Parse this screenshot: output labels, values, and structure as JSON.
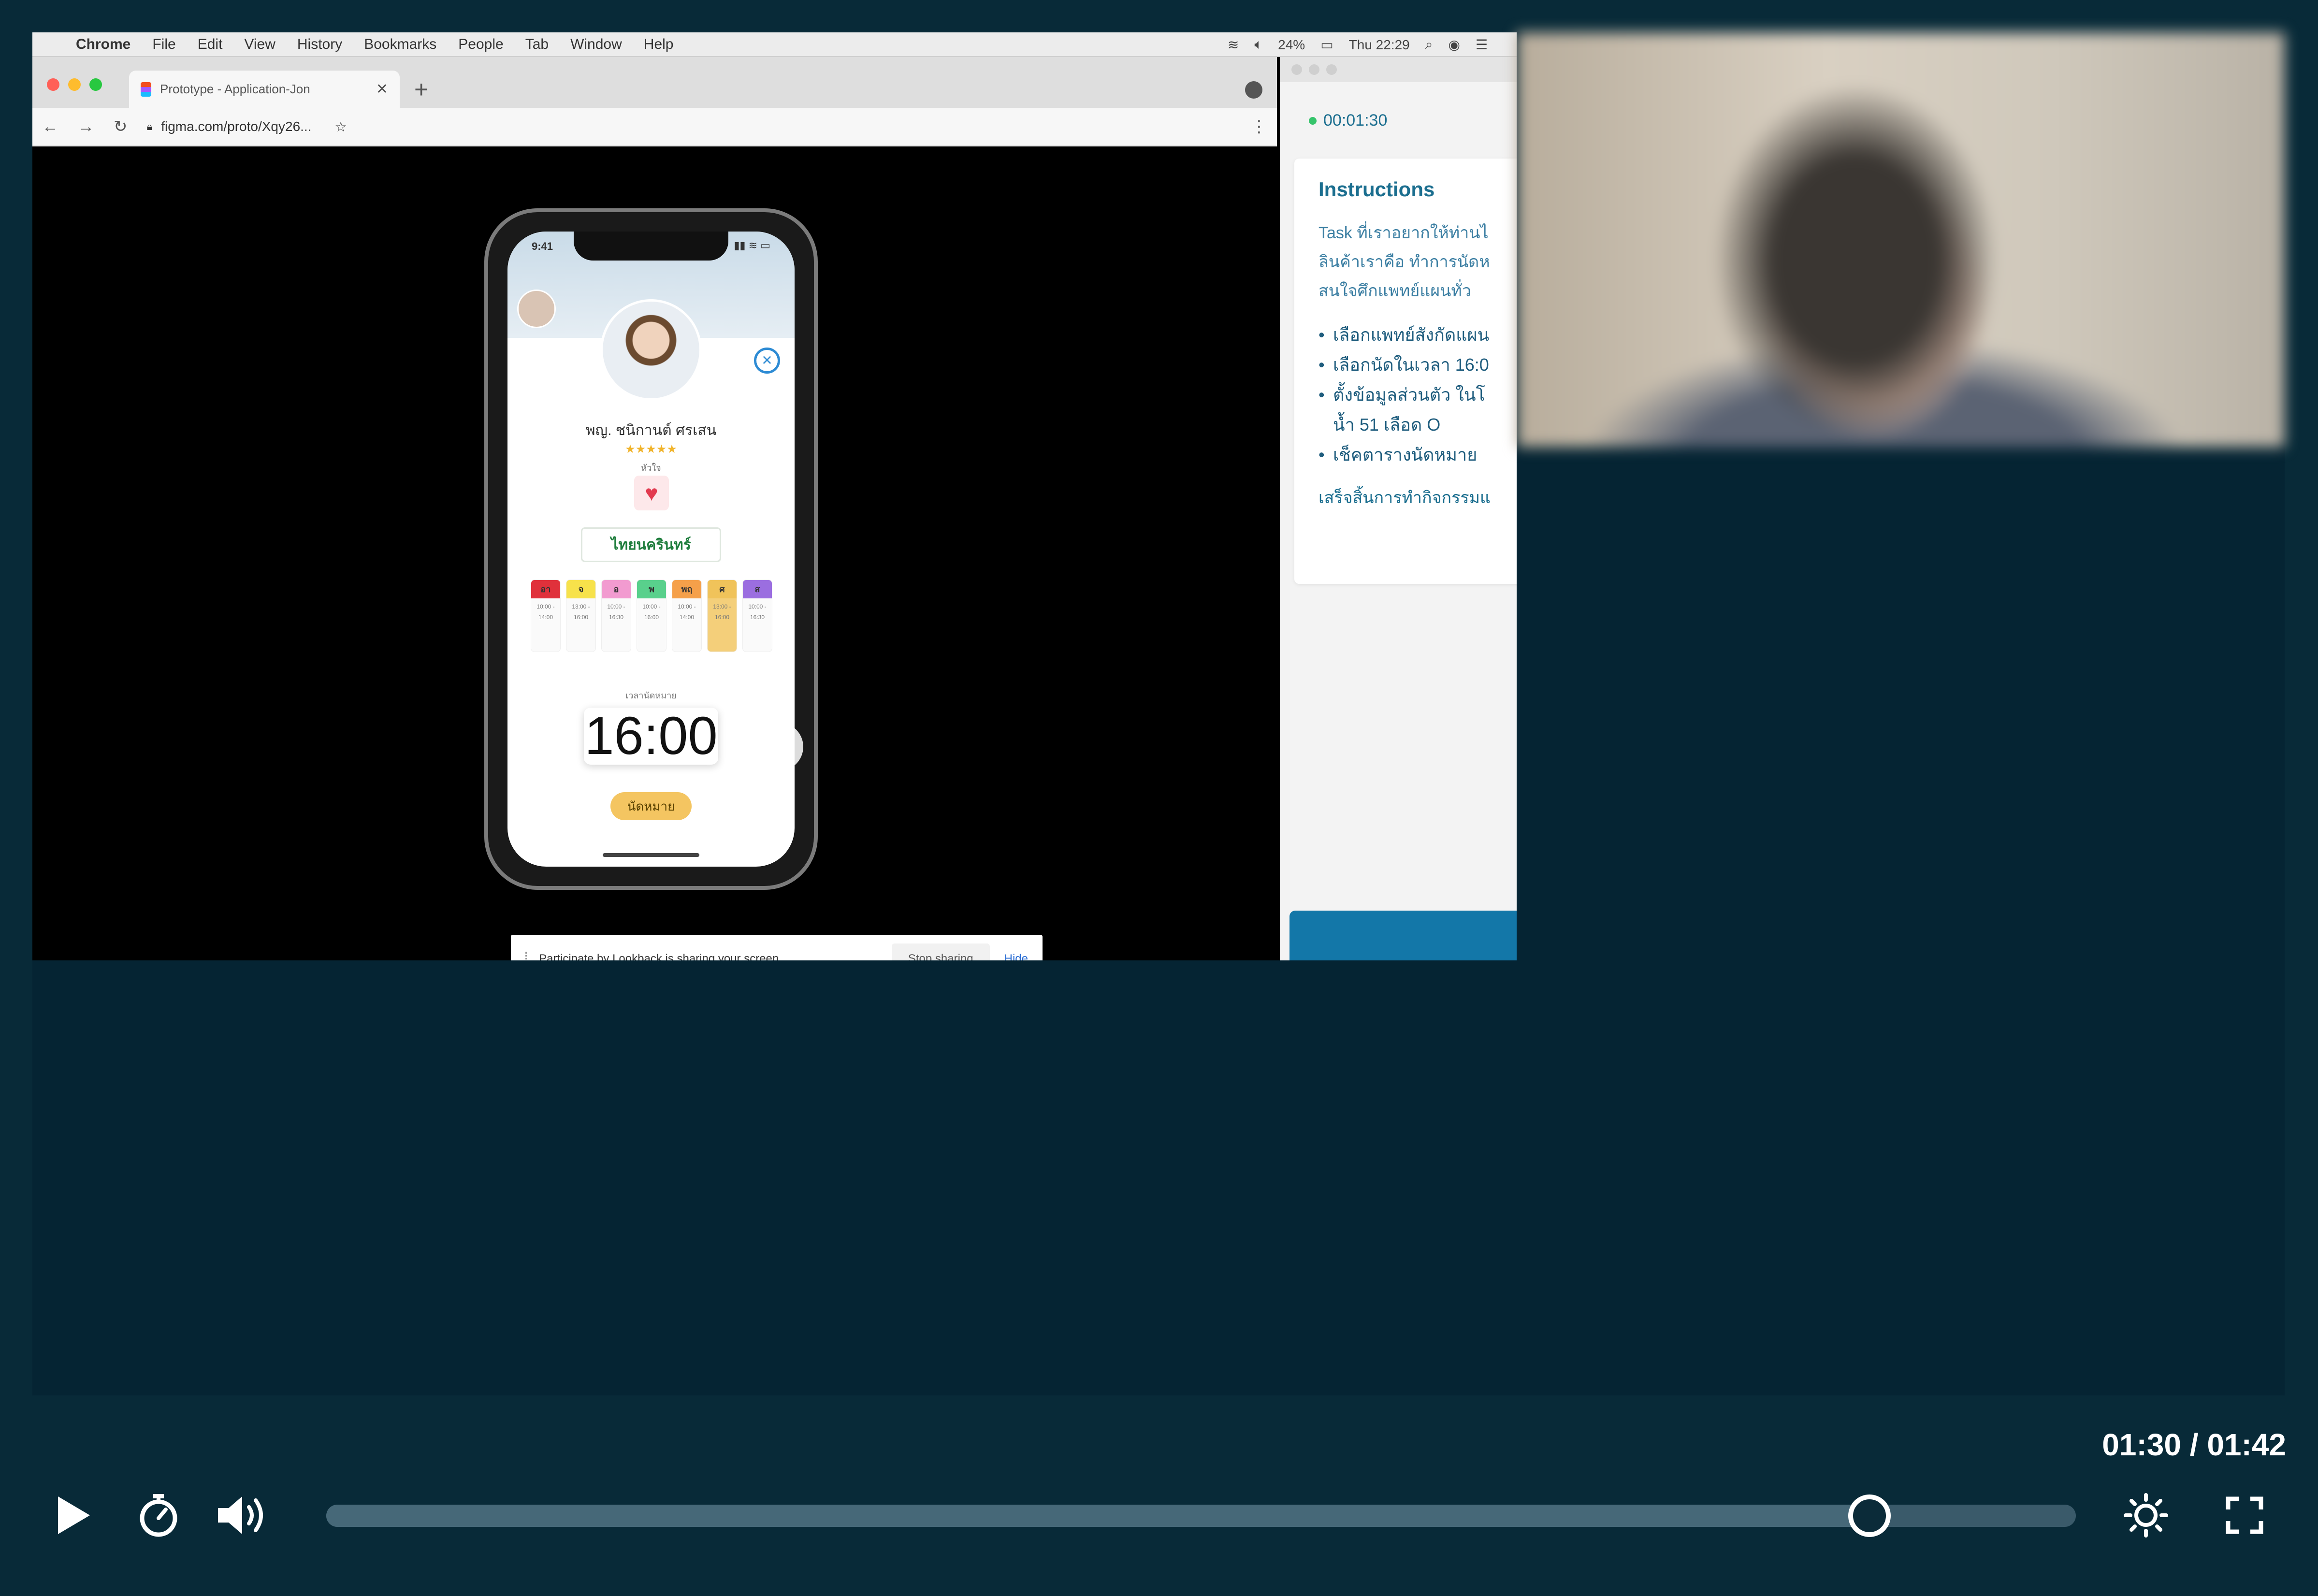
{
  "menubar": {
    "app": "Chrome",
    "items": [
      "File",
      "Edit",
      "View",
      "History",
      "Bookmarks",
      "People",
      "Tab",
      "Window",
      "Help"
    ],
    "battery": "24%",
    "clock": "Thu 22:29"
  },
  "browser": {
    "tab_title": "Prototype - Application-Jon",
    "url": "figma.com/proto/Xqy26...",
    "colors": {
      "close": "#ff5f57",
      "minimize": "#febc2e",
      "zoom": "#28c840"
    }
  },
  "phone": {
    "status_time": "9:41",
    "doctor_name": "พญ. ชนิกานต์ ศรเสน",
    "rating": "★★★★★",
    "specialty": "หัวใจ",
    "hospital": "ไทยนครินทร์",
    "days": [
      {
        "tag": "อา",
        "color": "#e0313b",
        "time": "10:00 - 14:00",
        "selected": false
      },
      {
        "tag": "จ",
        "color": "#f7e24b",
        "time": "13:00 - 16:00",
        "selected": false
      },
      {
        "tag": "อ",
        "color": "#f29bd0",
        "time": "10:00 - 16:30",
        "selected": false
      },
      {
        "tag": "พ",
        "color": "#59d08c",
        "time": "10:00 - 16:00",
        "selected": false
      },
      {
        "tag": "พฤ",
        "color": "#f5a04a",
        "time": "10:00 - 14:00",
        "selected": false
      },
      {
        "tag": "ศ",
        "color": "#f0c35a",
        "time": "13:00 - 16:00",
        "selected": true
      },
      {
        "tag": "ส",
        "color": "#9b6ee0",
        "time": "10:00 - 16:30",
        "selected": false
      }
    ],
    "time_caption": "เวลานัดหมาย",
    "selected_time": "16:00",
    "confirm_label": "นัดหมาย"
  },
  "share_bar": {
    "text": "Participate by Lookback is sharing your screen.",
    "stop_label": "Stop sharing",
    "hide_label": "Hide"
  },
  "side_panel": {
    "timer": "00:01:30",
    "instructions_title": "Instructions",
    "intro_lines": [
      "Task ที่เราอยากให้ท่านไ",
      "ลินค้าเราคือ ทำการนัดห",
      "สนใจศึกแพทย์แผนทั่ว"
    ],
    "tasks": [
      {
        "text": "เลือกแพทย์สังกัดแผน",
        "cont": false
      },
      {
        "text": "เลือกนัดในเวลา 16:0",
        "cont": false
      },
      {
        "text": "ตั้งข้อมูลส่วนตัว ในโ",
        "cont": false
      },
      {
        "text": "น้ำ 51 เลือด O",
        "cont": true
      },
      {
        "text": "เช็คตารางนัดหมาย",
        "cont": false
      }
    ],
    "footer": "เสร็จสิ้นการทำกิจกรรมแ"
  },
  "player": {
    "current": "01:30",
    "total": "01:42",
    "progress": 0.882
  },
  "icons": {
    "play": "play-icon",
    "timer": "stopwatch-icon",
    "volume": "volume-icon",
    "brightness": "brightness-icon",
    "fullscreen": "fullscreen-icon"
  }
}
